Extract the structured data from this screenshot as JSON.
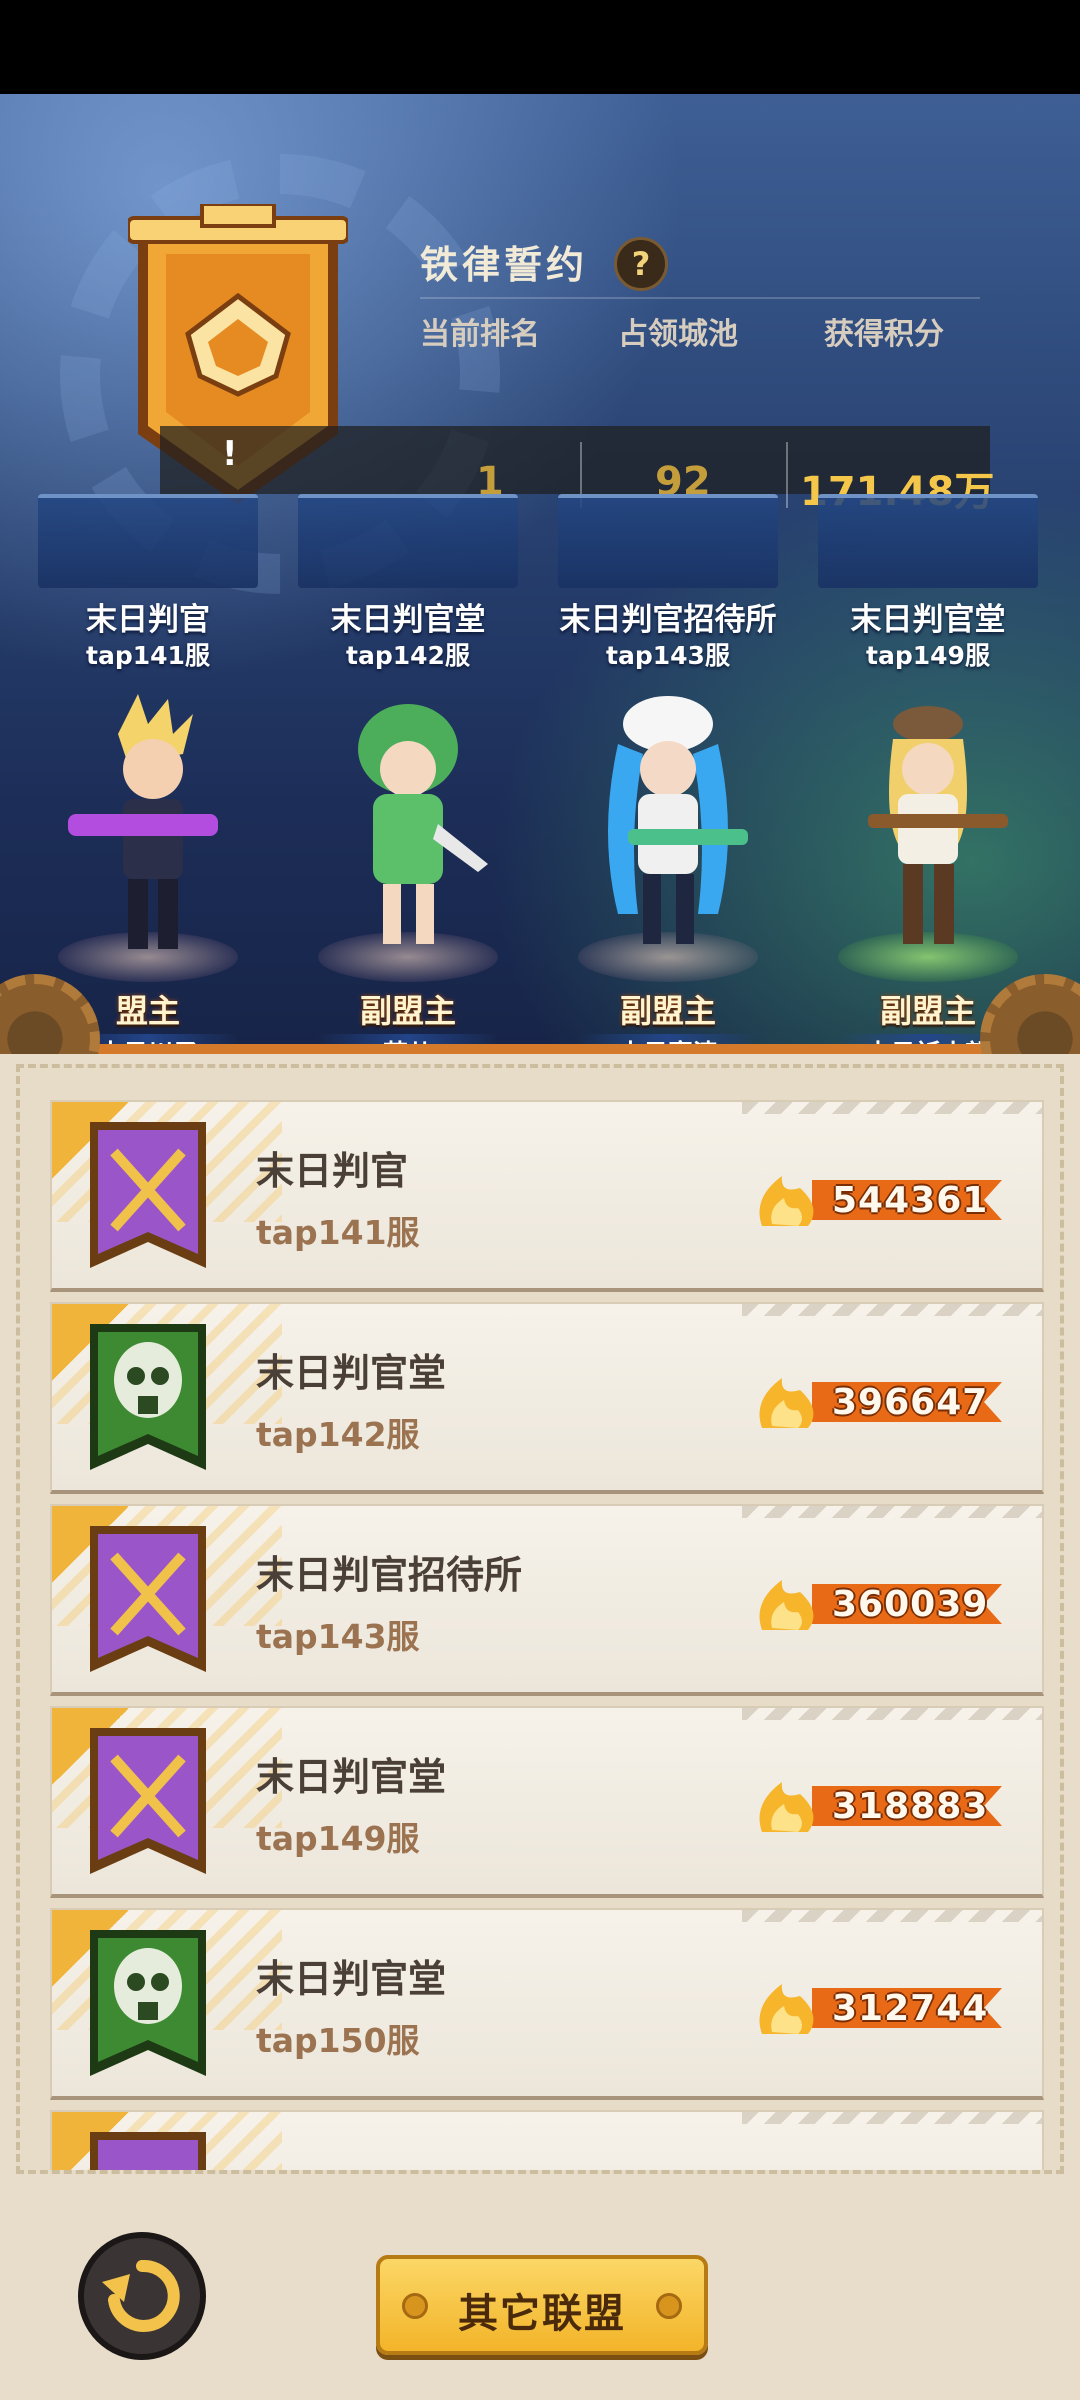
{
  "header": {
    "title": "铁律誓约",
    "help_icon": "?",
    "stats_labels": [
      "当前排名",
      "占领城池",
      "获得积分"
    ],
    "stats_values": [
      "1",
      "92",
      "171.48万"
    ],
    "overlay_text": "!"
  },
  "members": [
    {
      "guild": "末日判官",
      "server": "tap141服",
      "role": "盟主",
      "name": "末日川子"
    },
    {
      "guild": "末日判官堂",
      "server": "tap142服",
      "role": "副盟主",
      "name": "芸儿"
    },
    {
      "guild": "末日判官招待所",
      "server": "tap143服",
      "role": "副盟主",
      "name": "末日寒清"
    },
    {
      "guild": "末日判官堂",
      "server": "tap149服",
      "role": "副盟主",
      "name": "末日祈小望"
    }
  ],
  "list": [
    {
      "name": "末日判官",
      "server": "tap141服",
      "score": "544361",
      "emblem": "purple-crossed-guns-emblem"
    },
    {
      "name": "末日判官堂",
      "server": "tap142服",
      "score": "396647",
      "emblem": "green-gasmask-emblem"
    },
    {
      "name": "末日判官招待所",
      "server": "tap143服",
      "score": "360039",
      "emblem": "purple-crossed-guns-emblem"
    },
    {
      "name": "末日判官堂",
      "server": "tap149服",
      "score": "318883",
      "emblem": "purple-crossed-guns-emblem"
    },
    {
      "name": "末日判官堂",
      "server": "tap150服",
      "score": "312744",
      "emblem": "green-gasmask-emblem"
    }
  ],
  "buttons": {
    "other_alliance": "其它联盟"
  },
  "colors": {
    "gold": "#f4c74a",
    "panel_bg": "#e6dcc8",
    "score_flame": "#e86a16"
  }
}
